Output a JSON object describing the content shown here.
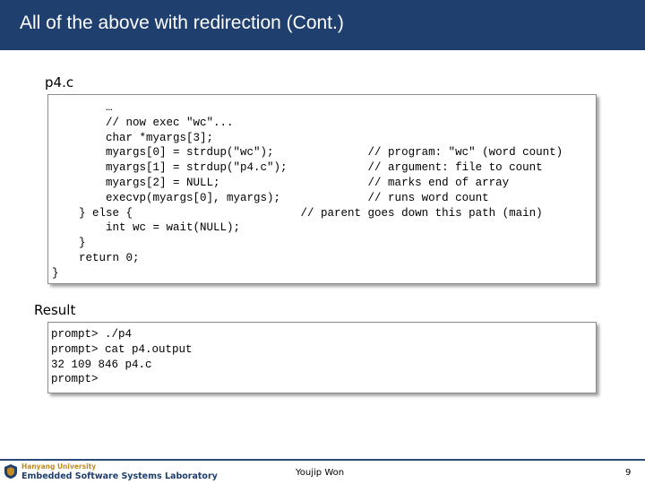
{
  "slide": {
    "title": "All of the above with redirection (Cont.)",
    "page_number": "9",
    "author": "Youjip Won"
  },
  "code_section": {
    "label": "p4.c",
    "lines": [
      "        …",
      "        // now exec \"wc\"...",
      "        char *myargs[3];",
      "        myargs[0] = strdup(\"wc\");              // program: \"wc\" (word count)",
      "        myargs[1] = strdup(\"p4.c\");            // argument: file to count",
      "        myargs[2] = NULL;                      // marks end of array",
      "        execvp(myargs[0], myargs);             // runs word count",
      "    } else {                         // parent goes down this path (main)",
      "        int wc = wait(NULL);",
      "    }",
      "    return 0;",
      "}"
    ]
  },
  "result_section": {
    "label": "Result",
    "lines": [
      "prompt> ./p4",
      "prompt> cat p4.output",
      "32 109 846 p4.c",
      "prompt>"
    ]
  },
  "footer": {
    "university": "Hanyang University",
    "lab": "Embedded Software Systems Laboratory"
  },
  "colors": {
    "header_bg": "#1f3f6e",
    "header_text": "#ffffff",
    "logo_gold": "#c08a20",
    "logo_blue": "#1f3f6e"
  },
  "icons": {
    "logo": "university-emblem-icon"
  }
}
